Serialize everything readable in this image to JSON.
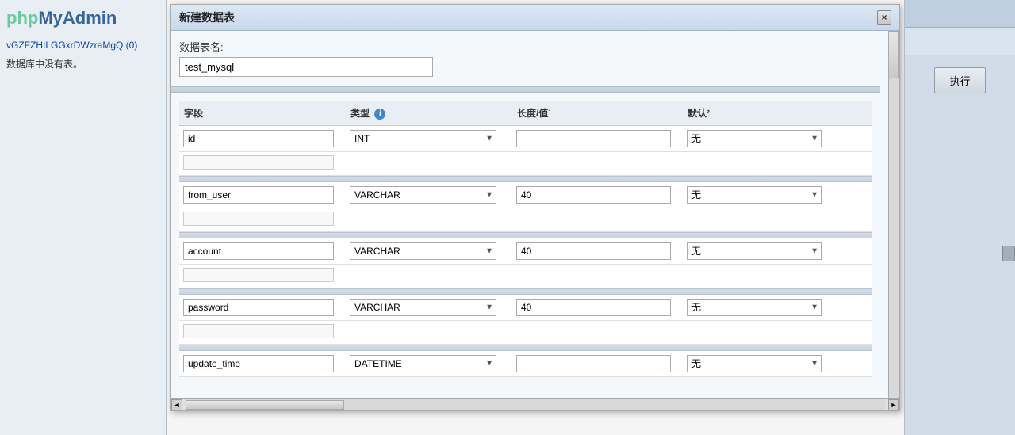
{
  "logo": {
    "php": "php",
    "myadmin": "MyAdmin"
  },
  "sidebar": {
    "link": "vGZFZHILGGxrDWzraMgQ (0)",
    "text": "数据库中没有表。"
  },
  "modal": {
    "title": "新建数据表",
    "close_label": "×",
    "table_name_label": "数据表名:",
    "table_name_value": "test_mysql",
    "columns_header": [
      "字段",
      "类型",
      "长度/值¹",
      "默认²"
    ],
    "fields": [
      {
        "name": "id",
        "type": "INT",
        "length": "",
        "default": "无"
      },
      {
        "name": "from_user",
        "type": "VARCHAR",
        "length": "40",
        "default": "无"
      },
      {
        "name": "account",
        "type": "VARCHAR",
        "length": "40",
        "default": "无"
      },
      {
        "name": "password",
        "type": "VARCHAR",
        "length": "40",
        "default": "无"
      },
      {
        "name": "update_time",
        "type": "DATETIME",
        "length": "",
        "default": "无"
      }
    ]
  },
  "right_panel": {
    "execute_button": "执行"
  }
}
